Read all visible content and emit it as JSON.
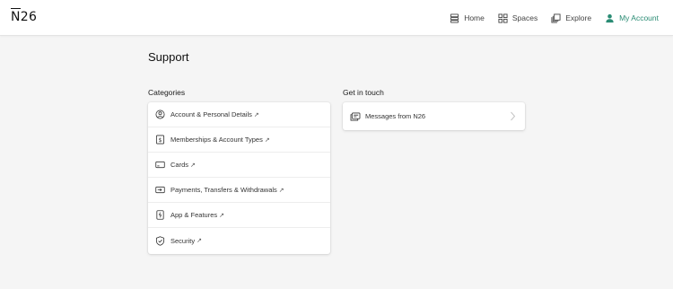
{
  "header": {
    "logo": "N26",
    "nav": [
      {
        "label": "Home",
        "icon": "home-icon"
      },
      {
        "label": "Spaces",
        "icon": "spaces-icon"
      },
      {
        "label": "Explore",
        "icon": "explore-icon"
      },
      {
        "label": "My Account",
        "icon": "account-icon"
      }
    ]
  },
  "page": {
    "title": "Support"
  },
  "categories": {
    "label": "Categories",
    "items": [
      {
        "label": "Account & Personal Details",
        "icon": "user-circle-icon"
      },
      {
        "label": "Memberships & Account Types",
        "icon": "membership-icon"
      },
      {
        "label": "Cards",
        "icon": "card-icon"
      },
      {
        "label": "Payments, Transfers & Withdrawals",
        "icon": "payments-icon"
      },
      {
        "label": "App & Features",
        "icon": "app-icon"
      },
      {
        "label": "Security",
        "icon": "shield-icon"
      }
    ],
    "external_marker": "↗"
  },
  "contact": {
    "label": "Get in touch",
    "messages_label": "Messages from N26",
    "icon": "messages-icon"
  },
  "colors": {
    "accent": "#2a8c74",
    "background": "#f5f5f5",
    "card": "#ffffff"
  }
}
